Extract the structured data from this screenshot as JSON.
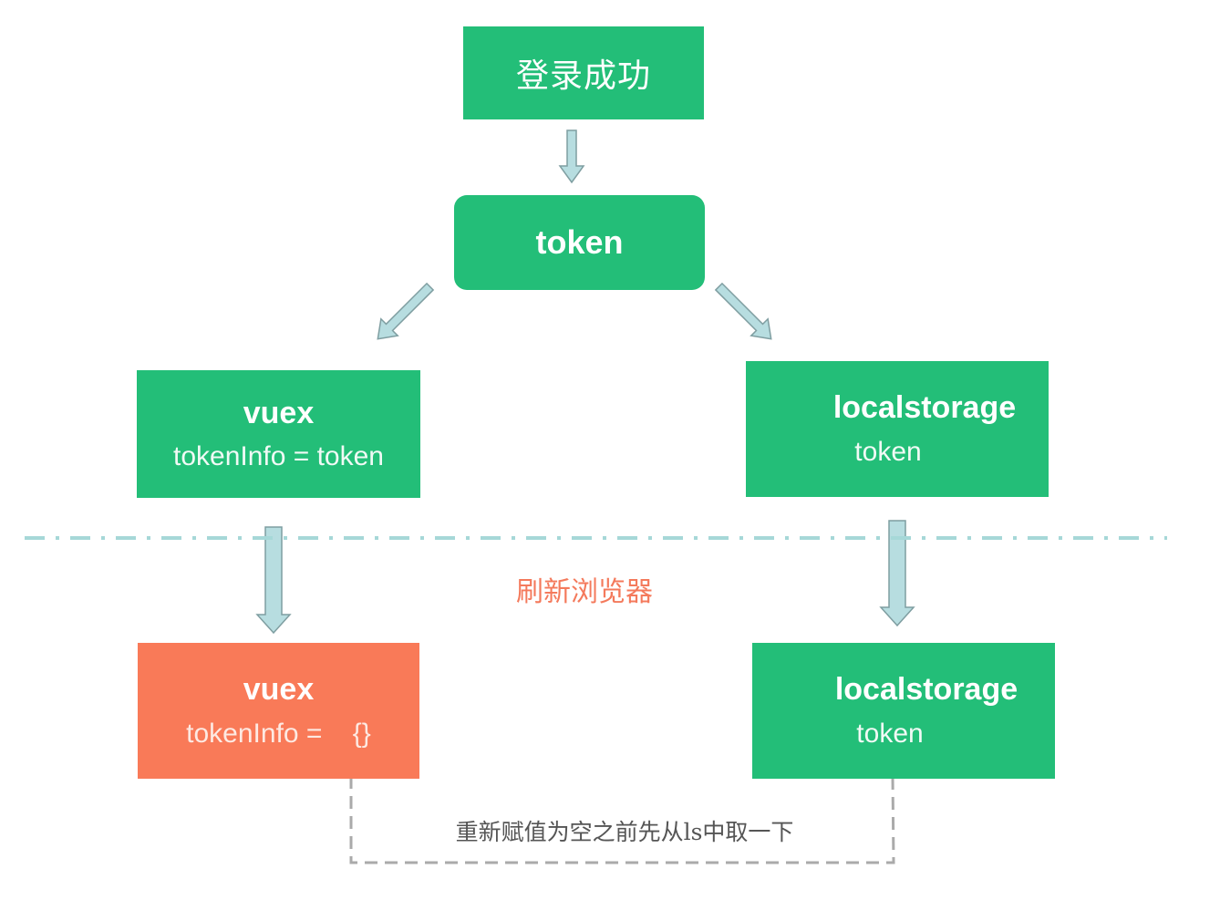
{
  "nodes": {
    "login_success": {
      "label": "登录成功"
    },
    "token": {
      "label": "token"
    },
    "vuex_before": {
      "title": "vuex",
      "detail": "tokenInfo = token"
    },
    "localstorage_before": {
      "title": "localstorage",
      "detail": "token"
    },
    "vuex_after": {
      "title": "vuex",
      "detail": "tokenInfo =    {}"
    },
    "localstorage_after": {
      "title": "localstorage",
      "detail": "token"
    }
  },
  "labels": {
    "refresh_browser": "刷新浏览器",
    "reassign_note": "重新赋值为空之前先从ls中取一下"
  },
  "colors": {
    "node_green": "#23be78",
    "node_orange": "#f97a58",
    "arrow_fill": "#b7dde0",
    "arrow_stroke": "#7f9ea1",
    "divider": "#a6d8d8",
    "dashed_connector": "#aaaaaa",
    "refresh_text": "#f47a5c"
  }
}
